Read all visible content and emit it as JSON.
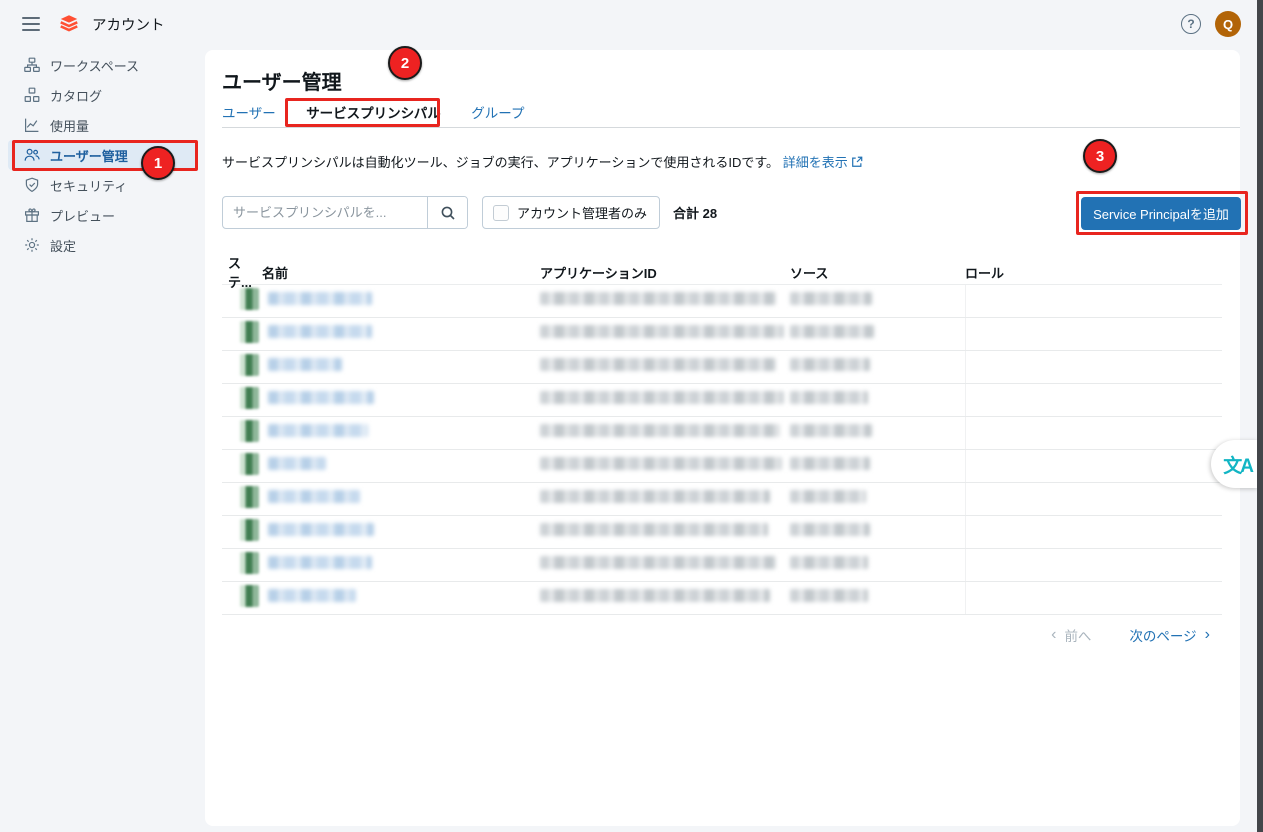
{
  "topbar": {
    "app_title": "アカウント",
    "avatar_initial": "Q",
    "help_glyph": "?"
  },
  "sidebar": {
    "items": [
      {
        "label": "ワークスペース",
        "selected": false
      },
      {
        "label": "カタログ",
        "selected": false
      },
      {
        "label": "使用量",
        "selected": false
      },
      {
        "label": "ユーザー管理",
        "selected": true
      },
      {
        "label": "セキュリティ",
        "selected": false
      },
      {
        "label": "プレビュー",
        "selected": false
      },
      {
        "label": "設定",
        "selected": false
      }
    ]
  },
  "main": {
    "title": "ユーザー管理",
    "tabs": [
      {
        "label": "ユーザー",
        "active": false
      },
      {
        "label": "サービスプリンシパル",
        "active": true
      },
      {
        "label": "グループ",
        "active": false
      }
    ],
    "description": "サービスプリンシパルは自動化ツール、ジョブの実行、アプリケーションで使用されるIDです。",
    "details_link": "詳細を表示",
    "search_placeholder": "サービスプリンシパルを...",
    "checkbox_label": "アカウント管理者のみ",
    "total_label": "合計",
    "total_value": "28",
    "add_button": "Service Principalを追加",
    "table": {
      "columns": [
        "ステ...",
        "名前",
        "アプリケーションID",
        "ソース",
        "ロール"
      ],
      "rows": [
        {
          "status": "active",
          "redacted": true,
          "name_w": 104,
          "id_w": 236,
          "src_w": 82
        },
        {
          "status": "active",
          "redacted": true,
          "name_w": 104,
          "id_w": 244,
          "src_w": 84
        },
        {
          "status": "active",
          "redacted": true,
          "name_w": 74,
          "id_w": 236,
          "src_w": 80
        },
        {
          "status": "active",
          "redacted": true,
          "name_w": 106,
          "id_w": 244,
          "src_w": 78
        },
        {
          "status": "active",
          "redacted": true,
          "name_w": 100,
          "id_w": 240,
          "src_w": 82
        },
        {
          "status": "active",
          "redacted": true,
          "name_w": 58,
          "id_w": 242,
          "src_w": 80
        },
        {
          "status": "active",
          "redacted": true,
          "name_w": 92,
          "id_w": 230,
          "src_w": 76
        },
        {
          "status": "active",
          "redacted": true,
          "name_w": 106,
          "id_w": 228,
          "src_w": 80
        },
        {
          "status": "active",
          "redacted": true,
          "name_w": 104,
          "id_w": 236,
          "src_w": 78
        },
        {
          "status": "active",
          "redacted": true,
          "name_w": 88,
          "id_w": 230,
          "src_w": 78
        }
      ]
    },
    "pagination": {
      "prev": "前へ",
      "next": "次のページ",
      "prev_enabled": false,
      "next_enabled": true
    }
  },
  "annotations": {
    "badges": [
      "1",
      "2",
      "3"
    ]
  },
  "translate_glyph": "文A",
  "colors": {
    "accent_blue": "#2272b4",
    "annotation_red": "#e8251f",
    "badge_red": "#ee2222",
    "status_green": "#417e52",
    "selected_item_bg": "#dfeaf5",
    "avatar_orange": "#b26407",
    "translate_teal": "#12b5c4",
    "page_bg": "#f3f5f8",
    "brand_red": "#ff4f33"
  }
}
